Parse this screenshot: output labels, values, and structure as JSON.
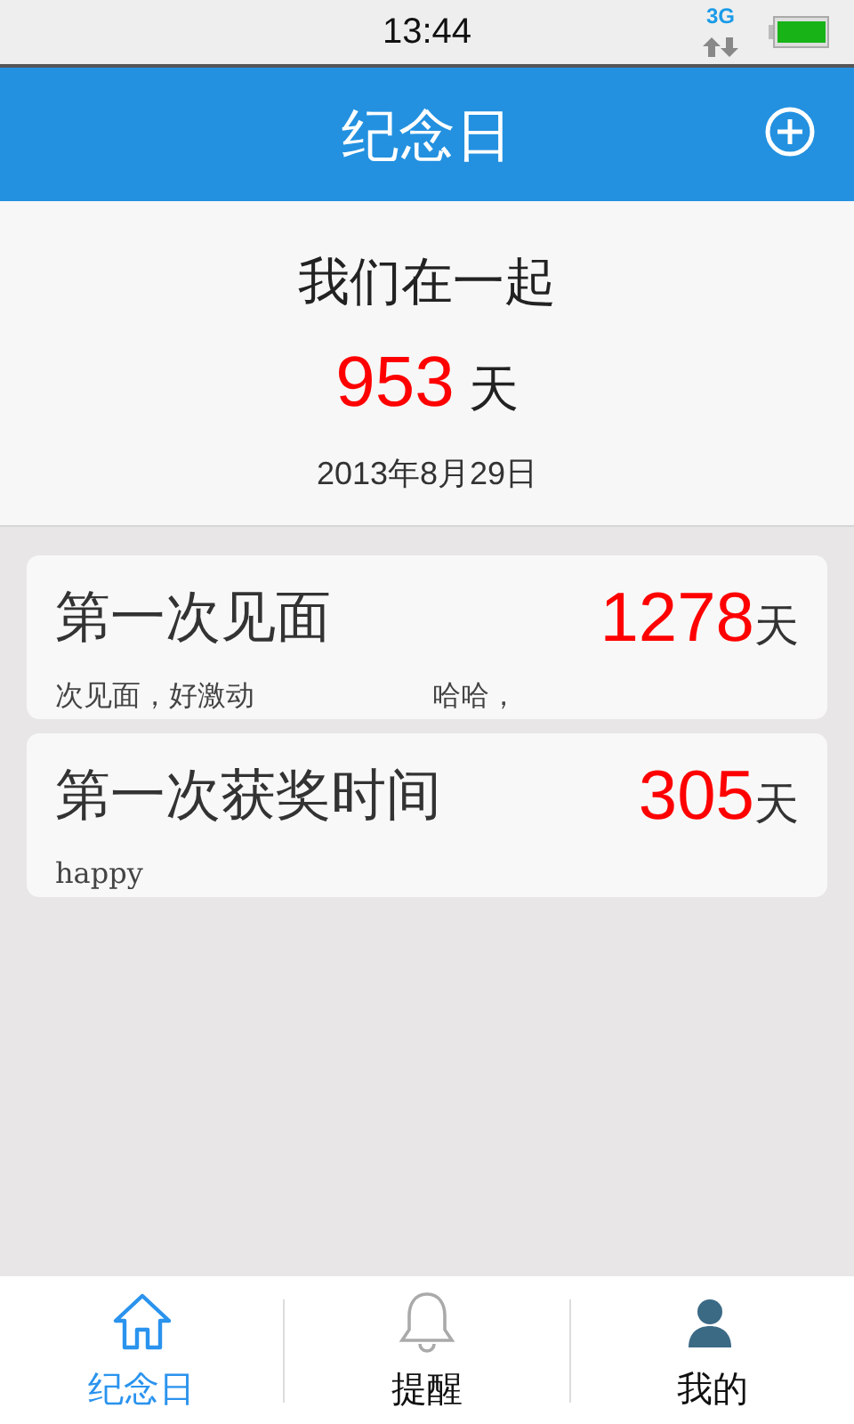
{
  "status_bar": {
    "time": "13:44",
    "network": "3G"
  },
  "header": {
    "title": "纪念日"
  },
  "summary": {
    "title": "我们在一起",
    "count": "953",
    "unit": "天",
    "date": "2013年8月29日"
  },
  "events": [
    {
      "title": "第一次见面",
      "count": "1278",
      "unit": "天",
      "note_segments": [
        "次见面，好激动",
        "哈哈，"
      ]
    },
    {
      "title": "第一次获奖时间",
      "count": "305",
      "unit": "天",
      "note_segments": [
        "happy"
      ]
    }
  ],
  "tabs": [
    {
      "label": "纪念日",
      "selected": true
    },
    {
      "label": "提醒",
      "selected": false
    },
    {
      "label": "我的",
      "selected": false
    }
  ]
}
